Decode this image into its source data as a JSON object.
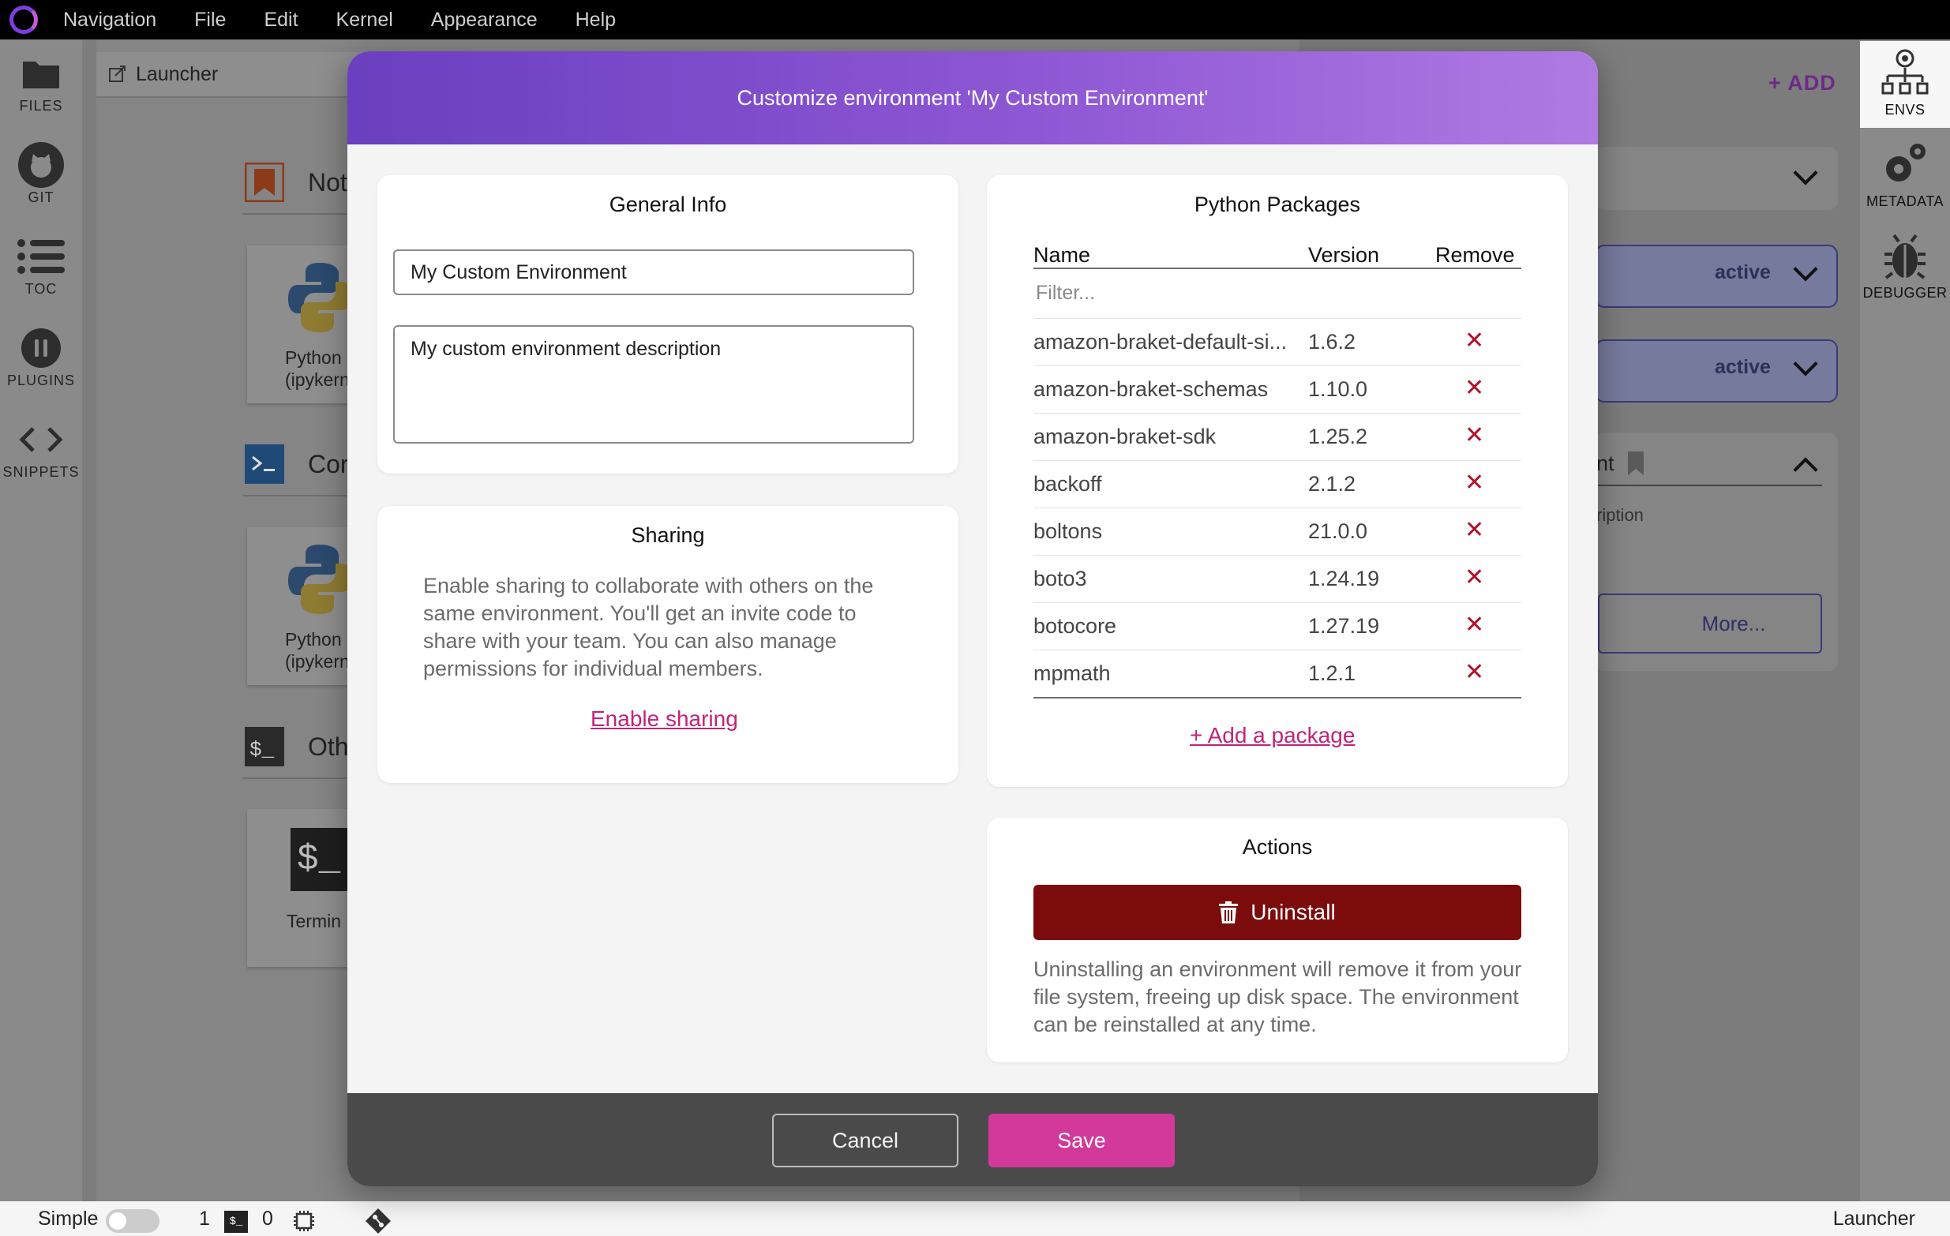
{
  "menubar": {
    "items": [
      "Navigation",
      "File",
      "Edit",
      "Kernel",
      "Appearance",
      "Help"
    ]
  },
  "leftbar": {
    "items": [
      {
        "label": "FILES",
        "icon": "folder-icon"
      },
      {
        "label": "GIT",
        "icon": "git-icon"
      },
      {
        "label": "TOC",
        "icon": "list-icon"
      },
      {
        "label": "PLUGINS",
        "icon": "plugin-icon"
      },
      {
        "label": "SNIPPETS",
        "icon": "code-icon"
      }
    ]
  },
  "launcher": {
    "tab_label": "Launcher",
    "sections": [
      {
        "title": "Not",
        "icon": "bookmark-icon"
      },
      {
        "title": "Cor",
        "icon": "console-icon"
      },
      {
        "title": "Oth",
        "icon": "terminal-icon"
      }
    ],
    "cards": [
      {
        "line1": "Python",
        "line2": "(ipykern"
      },
      {
        "line1": "Python",
        "line2": "(ipykern"
      },
      {
        "line1": "Termin",
        "line2": ""
      }
    ],
    "terminal_glyph": "$_"
  },
  "env_panel": {
    "add_label": "+ ADD",
    "envs": [
      {
        "status": ""
      },
      {
        "status": "active"
      },
      {
        "status": "active"
      }
    ],
    "open_env_title_fragment": "nt",
    "open_env_desc_fragment": "ription",
    "more_label": "More..."
  },
  "rightbar": {
    "items": [
      {
        "label": "ENVS",
        "icon": "envs-icon"
      },
      {
        "label": "METADATA",
        "icon": "gears-icon"
      },
      {
        "label": "DEBUGGER",
        "icon": "bug-icon"
      }
    ]
  },
  "statusbar": {
    "mode_label": "Simple",
    "terminals_count": "1",
    "kernels_count": "0",
    "right_label": "Launcher"
  },
  "modal": {
    "title": "Customize environment 'My Custom Environment'",
    "general_info": {
      "title": "General Info",
      "name_value": "My Custom Environment",
      "description_value": "My custom environment description"
    },
    "sharing": {
      "title": "Sharing",
      "text": "Enable sharing to collaborate with others on the same environment. You'll get an invite code to share with your team. You can also manage permissions for individual members.",
      "link": "Enable sharing"
    },
    "packages": {
      "title": "Python Packages",
      "columns": [
        "Name",
        "Version",
        "Remove"
      ],
      "filter_placeholder": "Filter...",
      "rows": [
        {
          "name": "amazon-braket-default-si...",
          "version": "1.6.2"
        },
        {
          "name": "amazon-braket-schemas",
          "version": "1.10.0"
        },
        {
          "name": "amazon-braket-sdk",
          "version": "1.25.2"
        },
        {
          "name": "backoff",
          "version": "2.1.2"
        },
        {
          "name": "boltons",
          "version": "21.0.0"
        },
        {
          "name": "boto3",
          "version": "1.24.19"
        },
        {
          "name": "botocore",
          "version": "1.27.19"
        },
        {
          "name": "mpmath",
          "version": "1.2.1"
        }
      ],
      "remove_glyph": "✕",
      "add_link": "+ Add a package"
    },
    "actions": {
      "title": "Actions",
      "uninstall_label": "Uninstall",
      "text": "Uninstalling an environment will remove it from your file system, freeing up disk space. The environment can be reinstalled at any time."
    },
    "cancel_label": "Cancel",
    "save_label": "Save"
  },
  "colors": {
    "header_start": "#6a3fc0",
    "header_end": "#b07ae3",
    "uninstall": "#7c0c0c",
    "save": "#d2399b",
    "link": "#c0247a",
    "remove": "#b2102a"
  }
}
